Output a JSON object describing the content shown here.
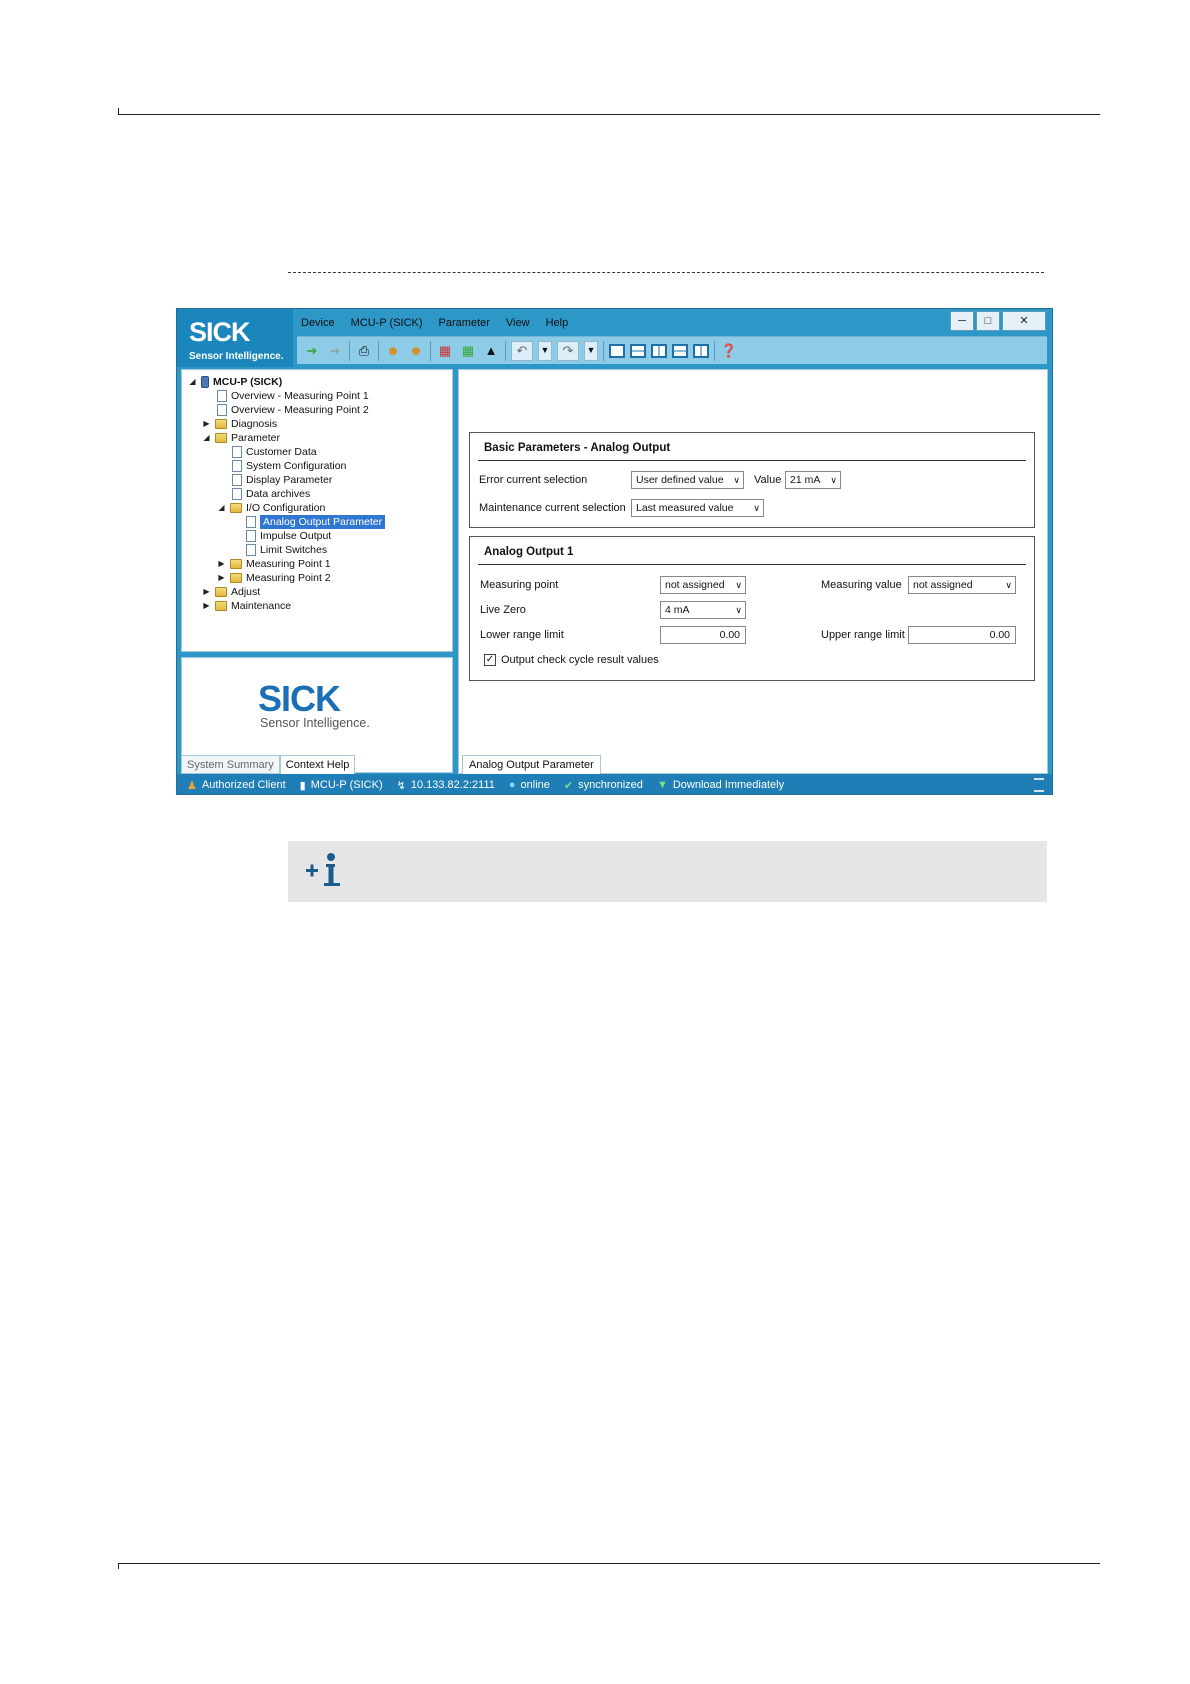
{
  "app": {
    "logo_text": "SICK",
    "logo_sub": "Sensor Intelligence.",
    "menu": [
      "Device",
      "MCU-P (SICK)",
      "Parameter",
      "View",
      "Help"
    ],
    "window_controls": [
      "minimize-icon",
      "maximize-icon",
      "close-icon"
    ],
    "tree": {
      "items": [
        {
          "label": "MCU-P (SICK)"
        },
        {
          "label": "Overview - Measuring Point 1"
        },
        {
          "label": "Overview - Measuring Point 2"
        },
        {
          "label": "Diagnosis"
        },
        {
          "label": "Parameter"
        },
        {
          "label": "Customer Data"
        },
        {
          "label": "System Configuration"
        },
        {
          "label": "Display Parameter"
        },
        {
          "label": "Data archives"
        },
        {
          "label": "I/O Configuration"
        },
        {
          "label": "Analog Output Parameter"
        },
        {
          "label": "Impulse Output"
        },
        {
          "label": "Limit Switches"
        },
        {
          "label": "Measuring Point 1"
        },
        {
          "label": "Measuring Point 2"
        },
        {
          "label": "Adjust"
        },
        {
          "label": "Maintenance"
        }
      ],
      "selected": "Analog Output Parameter"
    },
    "help_panel": {
      "logo_text": "SICK",
      "logo_sub": "Sensor Intelligence.",
      "tabs": [
        "System Summary",
        "Context Help"
      ],
      "active_tab": "Context Help"
    },
    "basic": {
      "title": "Basic Parameters - Analog Output",
      "error_label": "Error current selection",
      "error_value": "User defined value",
      "value_label": "Value",
      "value_value": "21 mA",
      "maint_label": "Maintenance current selection",
      "maint_value": "Last measured value"
    },
    "ao1": {
      "title": "Analog Output 1",
      "mp_label": "Measuring point",
      "mp_value": "not assigned",
      "mv_label": "Measuring value",
      "mv_value": "not assigned",
      "lz_label": "Live Zero",
      "lz_value": "4 mA",
      "lower_label": "Lower range limit",
      "lower_value": "0.00",
      "upper_label": "Upper range limit",
      "upper_value": "0.00",
      "check_label": "Output check cycle result values",
      "checked": true
    },
    "content_tab": "Analog Output Parameter",
    "status": {
      "client": "Authorized Client",
      "device": "MCU-P (SICK)",
      "ip": "10.133.82.2:2111",
      "online": "online",
      "sync": "synchronized",
      "download": "Download Immediately"
    }
  },
  "colors": {
    "app_frame": "#2d97c7",
    "status_bar": "#1e7eb5",
    "selection": "#2f77d1",
    "brand_blue": "#1b6fb5"
  }
}
